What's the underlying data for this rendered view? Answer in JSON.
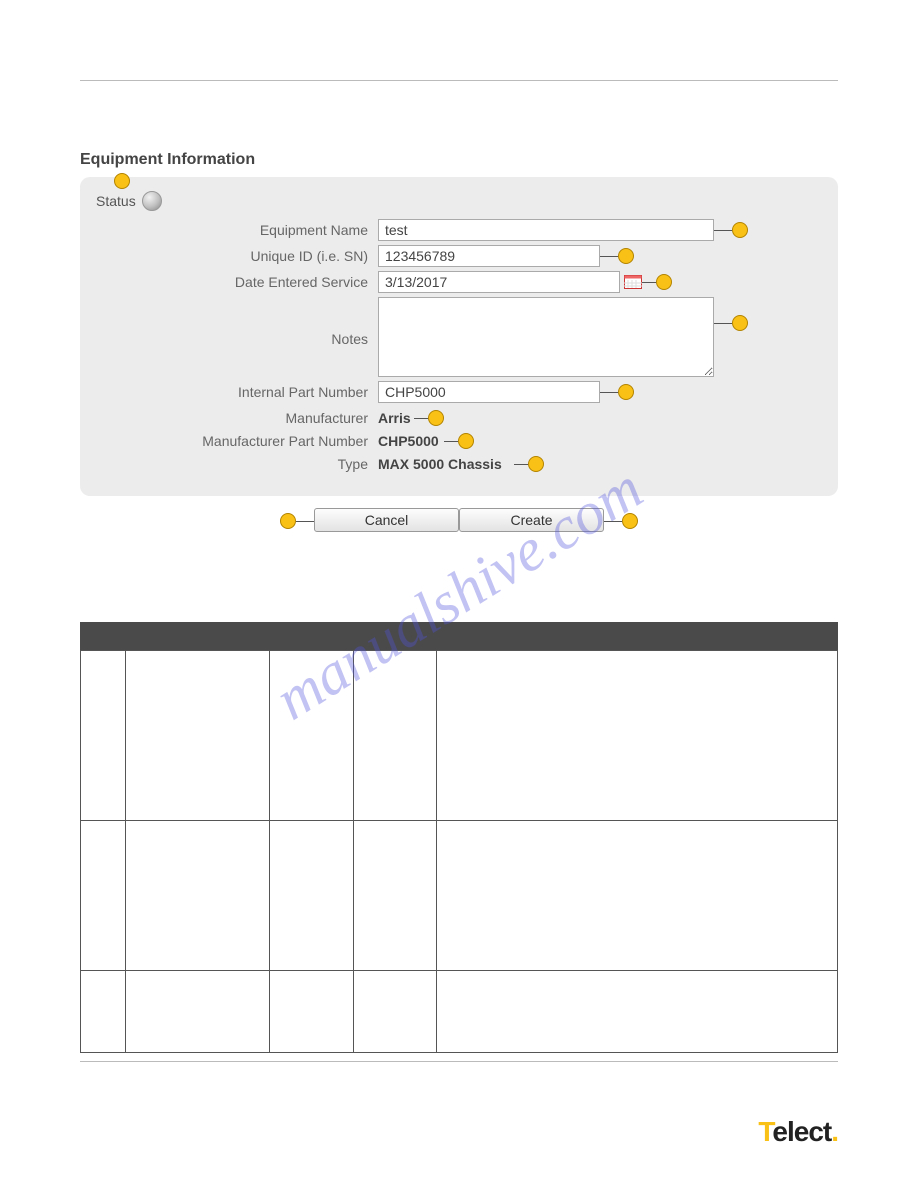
{
  "section_title": "Equipment Information",
  "status_label": "Status",
  "labels": {
    "equipment_name": "Equipment Name",
    "unique_id": "Unique ID (i.e. SN)",
    "date_entered": "Date Entered Service",
    "notes": "Notes",
    "internal_part": "Internal Part Number",
    "manufacturer": "Manufacturer",
    "mfr_part": "Manufacturer Part Number",
    "type": "Type"
  },
  "values": {
    "equipment_name": "test",
    "unique_id": "123456789",
    "date_entered": "3/13/2017",
    "notes": "",
    "internal_part": "CHP5000",
    "manufacturer": "Arris",
    "mfr_part": "CHP5000",
    "type": "MAX 5000 Chassis"
  },
  "buttons": {
    "cancel": "Cancel",
    "create": "Create"
  },
  "watermark": "manualshive.com",
  "logo_text": "Telect"
}
